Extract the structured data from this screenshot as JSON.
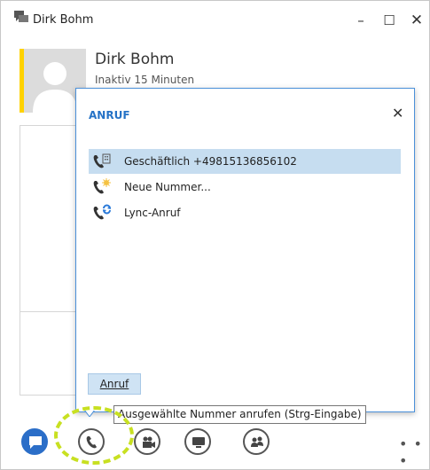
{
  "window": {
    "title": "Dirk Bohm",
    "minimize_label": "–",
    "maximize_label": "☐",
    "close_label": "✕"
  },
  "contact": {
    "name": "Dirk Bohm",
    "status": "Inaktiv 15 Minuten",
    "presence_color": "#ffd200"
  },
  "popup": {
    "title": "ANRUF",
    "close_label": "✕",
    "items": [
      {
        "label": "Geschäftlich +49815136856102",
        "icon": "work-phone-icon",
        "selected": true
      },
      {
        "label": "Neue Nummer...",
        "icon": "new-number-phone-icon",
        "selected": false
      },
      {
        "label": "Lync-Anruf",
        "icon": "lync-call-icon",
        "selected": false
      }
    ],
    "call_button_label": "Anruf"
  },
  "tooltip": {
    "text": "Ausgewählte Nummer anrufen (Strg-Eingabe)"
  },
  "toolbar": {
    "buttons": [
      {
        "name": "instant-message",
        "icon": "chat-bubble-icon"
      },
      {
        "name": "call",
        "icon": "phone-icon"
      },
      {
        "name": "video",
        "icon": "video-camera-icon"
      },
      {
        "name": "present",
        "icon": "monitor-icon"
      },
      {
        "name": "participants",
        "icon": "people-icon"
      }
    ],
    "more_label": "• • •"
  },
  "colors": {
    "accent": "#2572c6",
    "selection": "#c6ddf0",
    "highlight_ring": "#c8e021"
  }
}
